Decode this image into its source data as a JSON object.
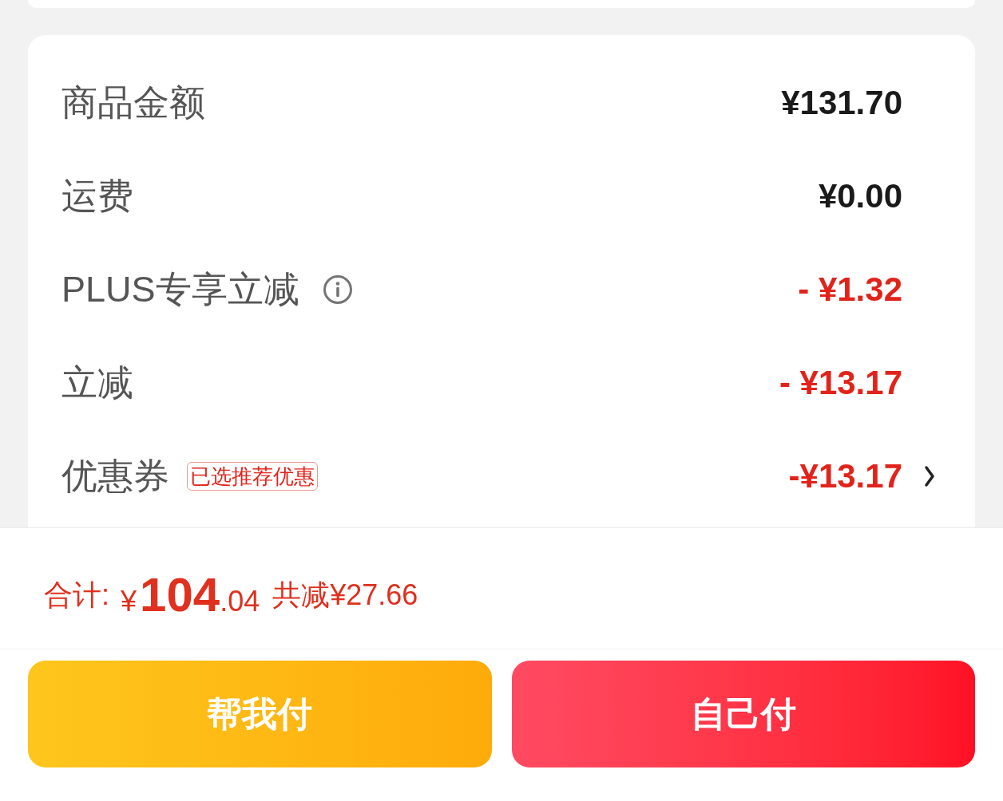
{
  "summary": {
    "rows": [
      {
        "kind": "charge",
        "label": "商品金额",
        "value": "¥131.70"
      },
      {
        "kind": "charge",
        "label": "运费",
        "value": "¥0.00"
      },
      {
        "kind": "deduction",
        "label": "PLUS专享立减",
        "info_icon": true,
        "value": "- ¥1.32"
      },
      {
        "kind": "deduction",
        "label": "立减",
        "value": "- ¥13.17"
      },
      {
        "kind": "deduction",
        "label": "优惠券",
        "badge": "已选推荐优惠",
        "value": "-¥13.17",
        "navigable": true
      }
    ]
  },
  "total": {
    "label": "合计:",
    "currency": "¥",
    "integer": "104",
    "decimal": ".04",
    "saving": "共减¥27.66"
  },
  "buttons": [
    {
      "kind": "secondary",
      "label": "帮我付"
    },
    {
      "kind": "primary",
      "label": "自己付"
    }
  ]
}
